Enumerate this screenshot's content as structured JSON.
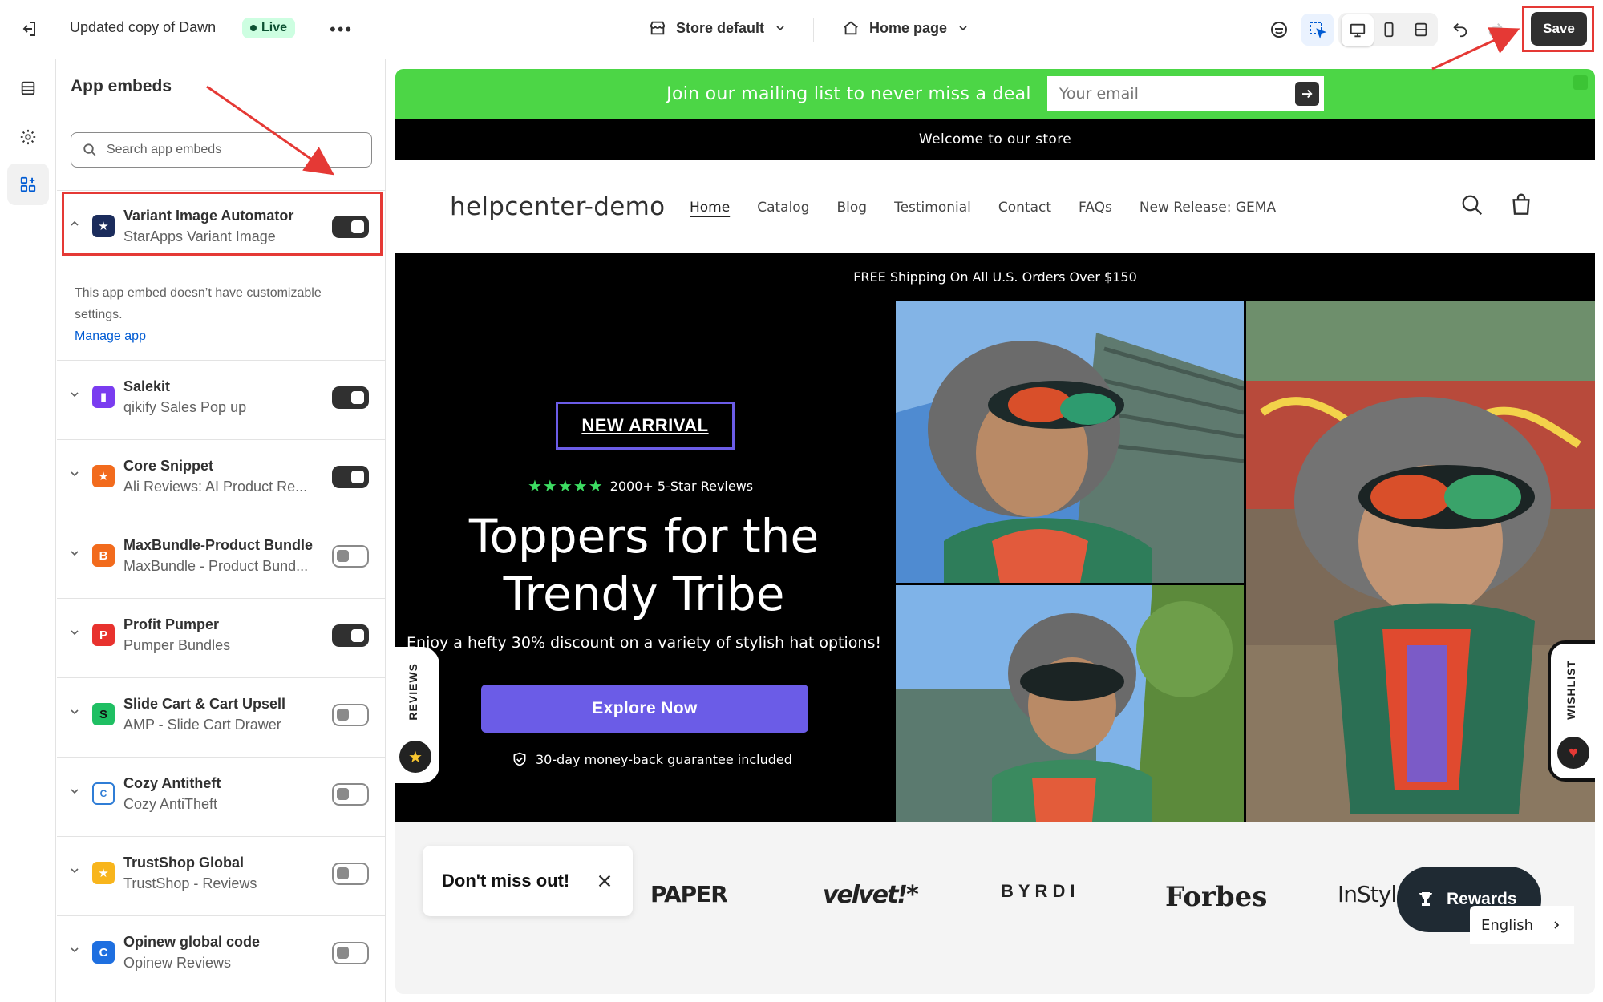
{
  "topbar": {
    "store_name": "Updated copy of Dawn",
    "status_badge": "Live",
    "store_selector": "Store default",
    "page_selector": "Home page",
    "save_label": "Save"
  },
  "panel": {
    "title": "App embeds",
    "search_placeholder": "Search app embeds",
    "expanded_note": "This app embed doesn’t have customizable settings.",
    "manage_link": "Manage app",
    "apps": [
      {
        "name": "Variant Image Automator",
        "sub": "StarApps Variant Image",
        "enabled": true,
        "expanded": true,
        "icon_color": "#1b2c5c",
        "icon_glyph": "★"
      },
      {
        "name": "Salekit",
        "sub": "qikify Sales Pop up",
        "enabled": true,
        "icon_color": "#7a3cf0",
        "icon_glyph": "▮"
      },
      {
        "name": "Core Snippet",
        "sub": "Ali Reviews: AI Product Re...",
        "enabled": true,
        "icon_color": "#f26b1d",
        "icon_glyph": "★"
      },
      {
        "name": "MaxBundle-Product Bundle",
        "sub": "MaxBundle - Product Bund...",
        "enabled": false,
        "icon_color": "#f26b1d",
        "icon_glyph": "B"
      },
      {
        "name": "Profit Pumper",
        "sub": "Pumper Bundles",
        "enabled": true,
        "icon_color": "#e8322e",
        "icon_glyph": "P"
      },
      {
        "name": "Slide Cart & Cart Upsell",
        "sub": "AMP - Slide Cart Drawer",
        "enabled": false,
        "icon_color": "#1fbf63",
        "icon_glyph": "S"
      },
      {
        "name": "Cozy Antitheft",
        "sub": "Cozy AntiTheft",
        "enabled": false,
        "icon_color": "#2f7dd6",
        "icon_glyph": "C"
      },
      {
        "name": "TrustShop Global",
        "sub": "TrustShop - Reviews",
        "enabled": false,
        "icon_color": "#f8b51c",
        "icon_glyph": "★"
      },
      {
        "name": "Opinew global code",
        "sub": "Opinew Reviews",
        "enabled": false,
        "icon_color": "#1e6fe0",
        "icon_glyph": "C"
      }
    ]
  },
  "preview": {
    "announcement": "Join our mailing list to never miss a deal",
    "email_placeholder": "Your email",
    "welcome": "Welcome to our store",
    "logo": "helpcenter-demo",
    "nav": [
      "Home",
      "Catalog",
      "Blog",
      "Testimonial",
      "Contact",
      "FAQs",
      "New Release: GEMA"
    ],
    "shipping": "FREE Shipping On All U.S. Orders Over $150",
    "badge": "NEW ARRIVAL",
    "stars": "★★★★★",
    "reviews_count": "2000+ 5-Star Reviews",
    "hero_title_line1": "Toppers for the",
    "hero_title_line2": "Trendy Tribe",
    "hero_sub": "Enjoy a hefty 30% discount on a variety of stylish hat options!",
    "cta": "Explore Now",
    "guarantee": "30-day money-back guarantee included",
    "reviews_tab": "REVIEWS",
    "wishlist_tab": "WISHLIST",
    "popup": "Don't miss out!",
    "press_logos": [
      "PAPER",
      "velvet!*",
      "BYRDI",
      "Forbes",
      "InStyle"
    ],
    "rewards": "Rewards",
    "language": "English"
  }
}
